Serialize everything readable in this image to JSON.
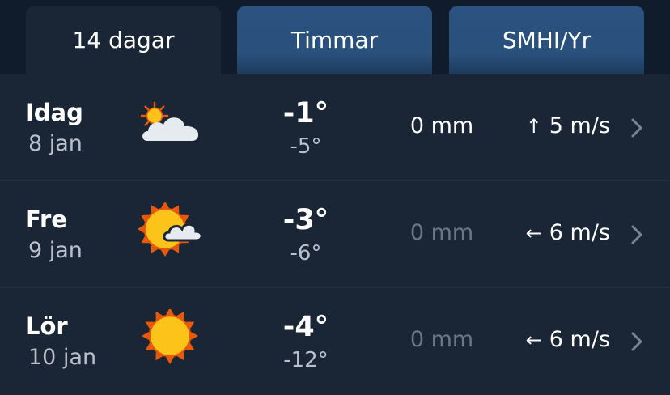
{
  "tabs": [
    {
      "label": "14 dagar",
      "active": true
    },
    {
      "label": "Timmar",
      "active": false
    },
    {
      "label": "SMHI/Yr",
      "active": false
    }
  ],
  "days": [
    {
      "day": "Idag",
      "date": "8 jan",
      "icon": "partly-cloudy-icon",
      "temp_max": "-1°",
      "temp_min": "-5°",
      "precip": "0 mm",
      "wind_direction_arrow": "↑",
      "wind_speed": "5 m/s"
    },
    {
      "day": "Fre",
      "date": "9 jan",
      "icon": "mostly-sunny-icon",
      "temp_max": "-3°",
      "temp_min": "-6°",
      "precip": "0 mm",
      "wind_direction_arrow": "←",
      "wind_speed": "6 m/s"
    },
    {
      "day": "Lör",
      "date": "10 jan",
      "icon": "sun-icon",
      "temp_max": "-4°",
      "temp_min": "-12°",
      "precip": "0 mm",
      "wind_direction_arrow": "←",
      "wind_speed": "6 m/s"
    }
  ],
  "colors": {
    "background": "#1a2535",
    "tab_inactive": "#2b5280",
    "sun": "#fcc419",
    "sun_rays": "#e8590c",
    "cloud": "#e6ebf0",
    "muted_text": "#b9c0ca",
    "dim_text": "#6c7785"
  }
}
